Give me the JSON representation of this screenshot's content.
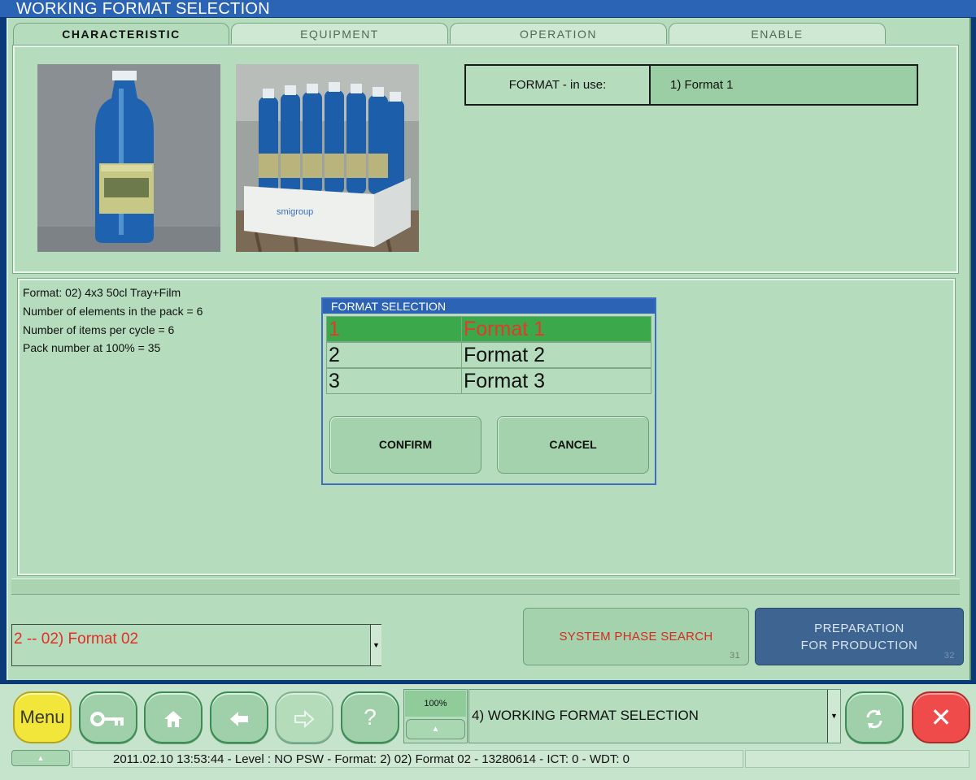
{
  "window": {
    "title": "WORKING FORMAT SELECTION"
  },
  "tabs": [
    {
      "label": "CHARACTERISTIC",
      "active": true
    },
    {
      "label": "EQUIPMENT"
    },
    {
      "label": "OPERATION"
    },
    {
      "label": "ENABLE"
    }
  ],
  "format_in_use": {
    "label": "FORMAT - in use:",
    "value": "1) Format 1"
  },
  "info": {
    "format": "Format: 02) 4x3 50cl Tray+Film",
    "elements": "Number of elements in the pack = 6",
    "items": "Number of items per cycle = 6",
    "pack": "Pack number at 100% = 35"
  },
  "photos": {
    "pack_brand": "smigroup"
  },
  "dialog": {
    "title": "FORMAT SELECTION",
    "rows": [
      {
        "num": "1",
        "name": "Format 1",
        "selected": true
      },
      {
        "num": "2",
        "name": "Format 2"
      },
      {
        "num": "3",
        "name": "Format 3"
      }
    ],
    "confirm": "CONFIRM",
    "cancel": "CANCEL"
  },
  "bottom": {
    "format_combo": "2 -- 02) Format 02",
    "phase_button": "SYSTEM PHASE SEARCH",
    "phase_num": "31",
    "prep_line1": "PREPARATION",
    "prep_line2": "FOR PRODUCTION",
    "prep_num": "32"
  },
  "taskbar": {
    "menu": "Menu",
    "zoom": "100%",
    "page": "4) WORKING FORMAT SELECTION",
    "status": "2011.02.10    13:53:44 - Level : NO PSW - Format: 2) 02) Format 02 - 13280614 - ICT: 0 - WDT: 0"
  },
  "colors": {
    "background": "#b5dcbc",
    "selected_row": "#3aa84b",
    "accent_blue": "#2d63b4",
    "alert_red": "#e32e22"
  }
}
